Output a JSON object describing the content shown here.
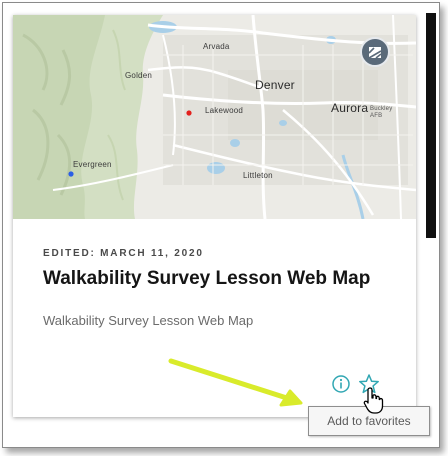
{
  "map": {
    "labels": {
      "arvada": "Arvada",
      "golden": "Golden",
      "denver": "Denver",
      "aurora": "Aurora",
      "lakewood": "Lakewood",
      "buckley": "Buckley AFB",
      "evergreen": "Evergreen",
      "littleton": "Littleton"
    },
    "colors": {
      "land": "#ecebe6",
      "hills": "#d3dfc3",
      "water": "#a9cfe8",
      "road": "#ffffff",
      "marker_red": "#e3211d",
      "marker_blue": "#2a5ee6"
    },
    "badge_icon": "map-type-icon"
  },
  "item": {
    "edited_label": "EDITED: MARCH 11, 2020",
    "title": "Walkability Survey Lesson Web Map",
    "description": "Walkability Survey Lesson Web Map"
  },
  "actions": {
    "info_icon": "info-icon",
    "favorite_icon": "star-icon",
    "accent_color": "#31a7b3"
  },
  "tooltip": {
    "text": "Add to favorites"
  },
  "annotation": {
    "arrow_color": "#d9eb2b"
  }
}
